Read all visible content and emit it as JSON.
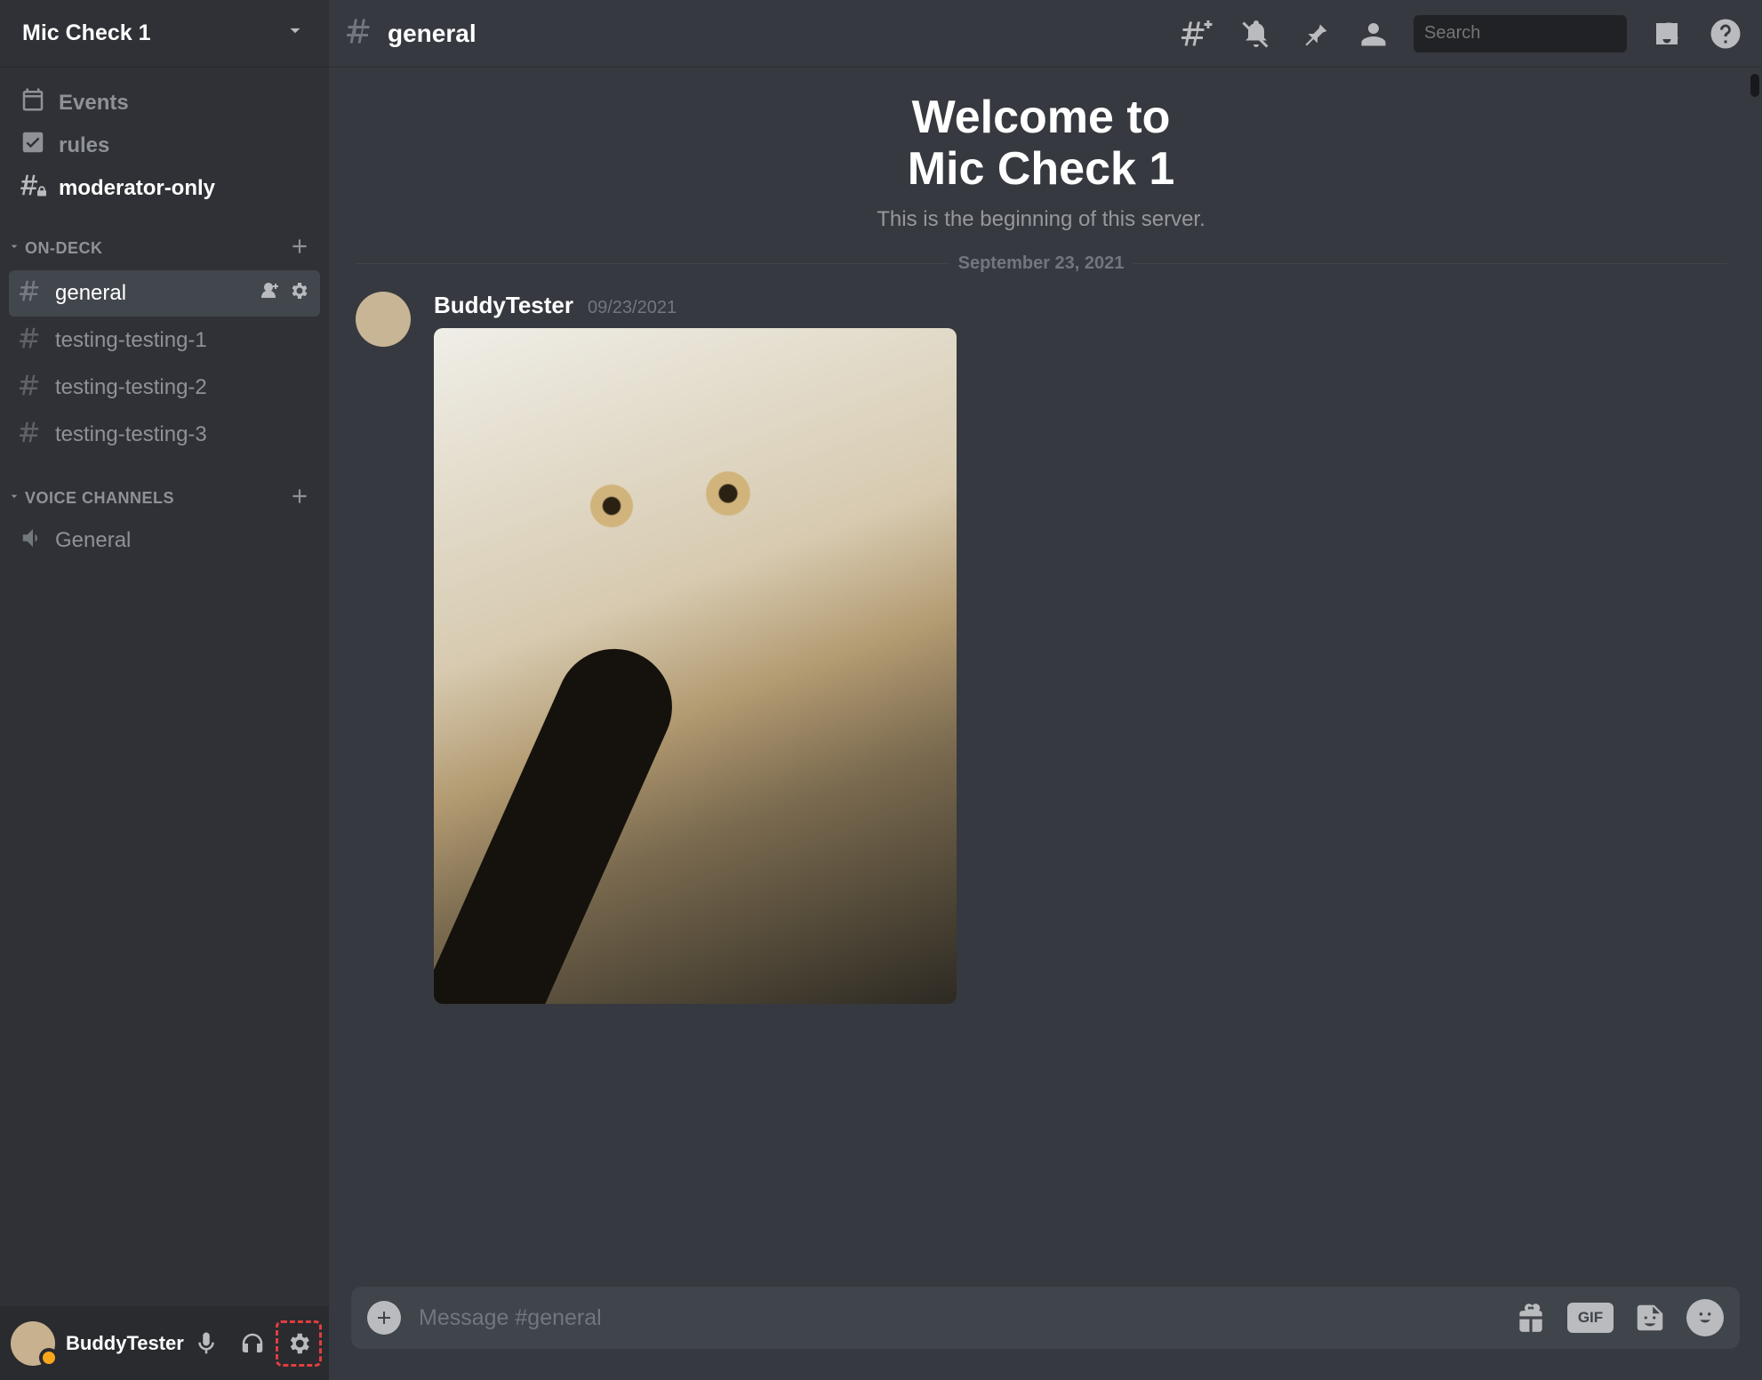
{
  "server": {
    "name": "Mic Check 1"
  },
  "top_items": [
    {
      "label": "Events",
      "icon": "calendar"
    },
    {
      "label": "rules",
      "icon": "rules-check"
    },
    {
      "label": "moderator-only",
      "icon": "hash-lock"
    }
  ],
  "categories": [
    {
      "name": "ON-DECK",
      "channels": [
        {
          "name": "general",
          "selected": true
        },
        {
          "name": "testing-testing-1",
          "selected": false
        },
        {
          "name": "testing-testing-2",
          "selected": false
        },
        {
          "name": "testing-testing-3",
          "selected": false
        }
      ]
    },
    {
      "name": "VOICE CHANNELS",
      "voice": [
        {
          "name": "General"
        }
      ]
    }
  ],
  "user_panel": {
    "username": "BuddyTester"
  },
  "chat_header": {
    "channel": "general",
    "search_placeholder": "Search"
  },
  "welcome": {
    "line1": "Welcome to",
    "line2": "Mic Check 1",
    "subtitle": "This is the beginning of this server."
  },
  "date_divider": "September 23, 2021",
  "message": {
    "author": "BuddyTester",
    "timestamp": "09/23/2021"
  },
  "composer": {
    "placeholder": "Message #general",
    "gif_label": "GIF"
  }
}
